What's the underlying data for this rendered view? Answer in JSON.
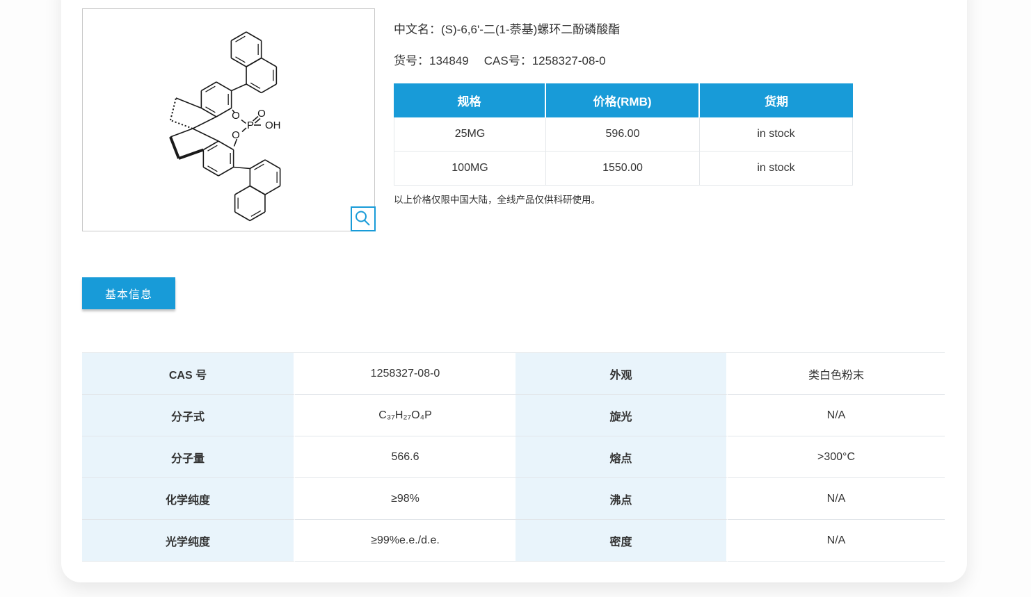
{
  "product": {
    "name_label": "中文名：",
    "name": "(S)-6,6'-二(1-萘基)螺环二酚磷酸酯",
    "sku_label": "货号：",
    "sku": "134849",
    "cas_label": "CAS号：",
    "cas": "1258327-08-0"
  },
  "price_table": {
    "headers": [
      "规格",
      "价格(RMB)",
      "货期"
    ],
    "rows": [
      [
        "25MG",
        "596.00",
        "in stock"
      ],
      [
        "100MG",
        "1550.00",
        "in stock"
      ]
    ]
  },
  "price_note": "以上价格仅限中国大陆，全线产品仅供科研使用。",
  "tab": {
    "basic_info": "基本信息"
  },
  "details": {
    "rows": [
      [
        "CAS 号",
        "1258327-08-0",
        "外观",
        "类白色粉末"
      ],
      [
        "分子式",
        "C₃₇H₂₇O₄P",
        "旋光",
        "N/A"
      ],
      [
        "分子量",
        "566.6",
        "熔点",
        ">300°C"
      ],
      [
        "化学纯度",
        "≥98%",
        "沸点",
        "N/A"
      ],
      [
        "光学纯度",
        "≥99%e.e./d.e.",
        "密度",
        "N/A"
      ]
    ]
  },
  "molecule": {
    "labels": {
      "o_top": "O",
      "o_bottom": "O",
      "p": "P",
      "o_double": "O",
      "oh": "OH"
    }
  },
  "icons": {
    "zoom_button": "magnifier-icon"
  },
  "colors": {
    "accent_blue": "#189bd8",
    "label_cell_bg": "#e9f4fb"
  }
}
